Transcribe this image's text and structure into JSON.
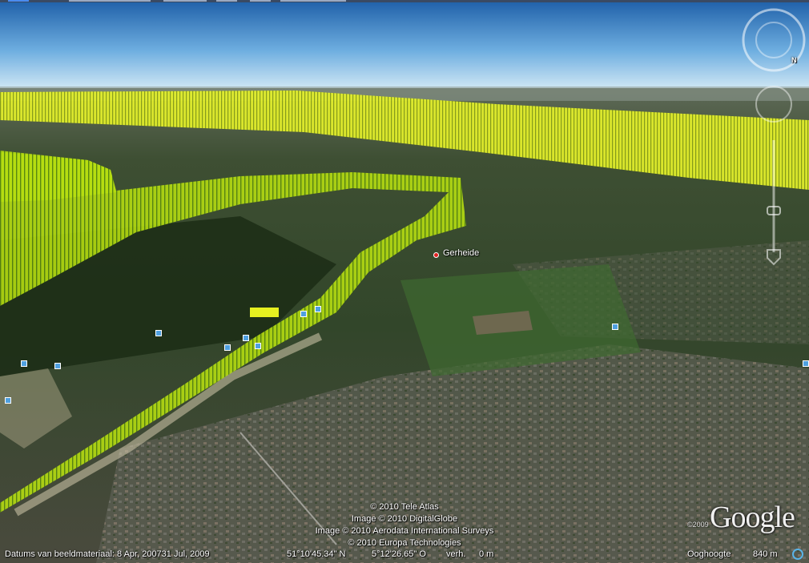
{
  "place": {
    "name": "Gerheide"
  },
  "attribution": [
    "© 2010 Tele Atlas",
    "Image © 2010 DigitalGlobe",
    "Image © 2010 Aerodata International Surveys",
    "© 2010 Europa Technologies"
  ],
  "logo": {
    "text": "Google",
    "year": "©2009"
  },
  "compass": {
    "north_label": "N"
  },
  "status": {
    "imagery_dates": "Datums van beeldmateriaal: 8 Apr, 200731 Jul, 2009",
    "lat": "51°10'45.34\" N",
    "lon": "5°12'26.65\" O",
    "elev_label": "verh.",
    "elev_value": "0 m",
    "eye_label": "Ooghoogte",
    "eye_value": "840 m"
  },
  "colors": {
    "track": "#d8f020",
    "sky_top": "#1e5fa8",
    "sky_bottom": "#cfe6f4"
  }
}
